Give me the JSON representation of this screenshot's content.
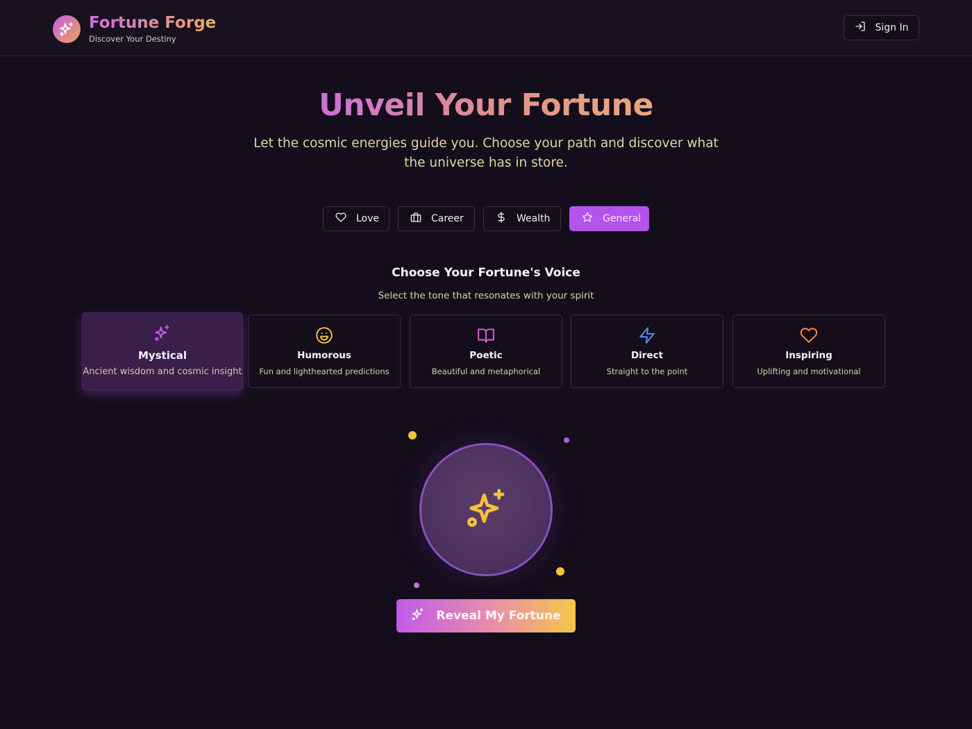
{
  "header": {
    "brand_title": "Fortune Forge",
    "brand_subtitle": "Discover Your Destiny",
    "signin_label": "Sign In"
  },
  "hero": {
    "title": "Unveil Your Fortune",
    "subtitle": "Let the cosmic energies guide you. Choose your path and discover what the universe has in store."
  },
  "categories": [
    {
      "label": "Love",
      "icon": "heart-icon",
      "active": false
    },
    {
      "label": "Career",
      "icon": "briefcase-icon",
      "active": false
    },
    {
      "label": "Wealth",
      "icon": "dollar-icon",
      "active": false
    },
    {
      "label": "General",
      "icon": "star-icon",
      "active": true
    }
  ],
  "voice": {
    "title": "Choose Your Fortune's Voice",
    "subtitle": "Select the tone that resonates with your spirit",
    "tones": [
      {
        "name": "Mystical",
        "description": "Ancient wisdom and cosmic insight",
        "icon": "sparkles-icon",
        "color": "#c45ce6",
        "active": true
      },
      {
        "name": "Humorous",
        "description": "Fun and lighthearted predictions",
        "icon": "smile-icon",
        "color": "#f3c43c",
        "active": false
      },
      {
        "name": "Poetic",
        "description": "Beautiful and metaphorical",
        "icon": "book-open-icon",
        "color": "#d563d8",
        "active": false
      },
      {
        "name": "Direct",
        "description": "Straight to the point",
        "icon": "zap-icon",
        "color": "#5b8df0",
        "active": false
      },
      {
        "name": "Inspiring",
        "description": "Uplifting and motivational",
        "icon": "heart-icon",
        "color": "#f08a3c",
        "active": false
      }
    ]
  },
  "reveal_label": "Reveal My Fortune",
  "colors": {
    "background": "#140e1c",
    "accent_purple": "#b453ec",
    "accent_gold": "#f5c64a"
  }
}
